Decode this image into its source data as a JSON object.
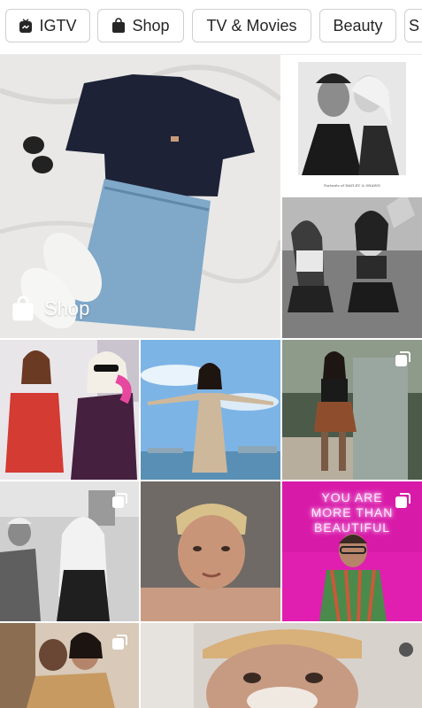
{
  "tabs": [
    {
      "label": "IGTV",
      "icon": "igtv-icon"
    },
    {
      "label": "Shop",
      "icon": "shopping-bag-icon"
    },
    {
      "label": "TV & Movies",
      "icon": ""
    },
    {
      "label": "Beauty",
      "icon": ""
    },
    {
      "label": "S",
      "icon": ""
    }
  ],
  "feed": {
    "featured": {
      "badge_label": "Shop",
      "badge_icon": "shopping-bag-icon"
    },
    "neon_sign": {
      "line1": "YOU ARE",
      "line2": "MORE THAN",
      "line3": "BEAUTIFUL"
    },
    "photo_caption": "Portraits of HAYLEY & SHAWN",
    "tiles": [
      {
        "description": "flat-lay outfit",
        "multi": false
      },
      {
        "description": "couple portrait",
        "multi": false
      },
      {
        "description": "cheerleaders",
        "multi": false
      },
      {
        "description": "party scene",
        "multi": false
      },
      {
        "description": "beach pose",
        "multi": false
      },
      {
        "description": "mirror selfie",
        "multi": true
      },
      {
        "description": "backstage candid",
        "multi": true
      },
      {
        "description": "close-up face",
        "multi": false
      },
      {
        "description": "neon sign portrait",
        "multi": true
      },
      {
        "description": "family moment",
        "multi": true
      },
      {
        "description": "face mask selfie",
        "multi": false
      }
    ]
  },
  "colors": {
    "chip_border": "#cfcfcf",
    "text": "#262626",
    "neon": "#e01fb0"
  }
}
